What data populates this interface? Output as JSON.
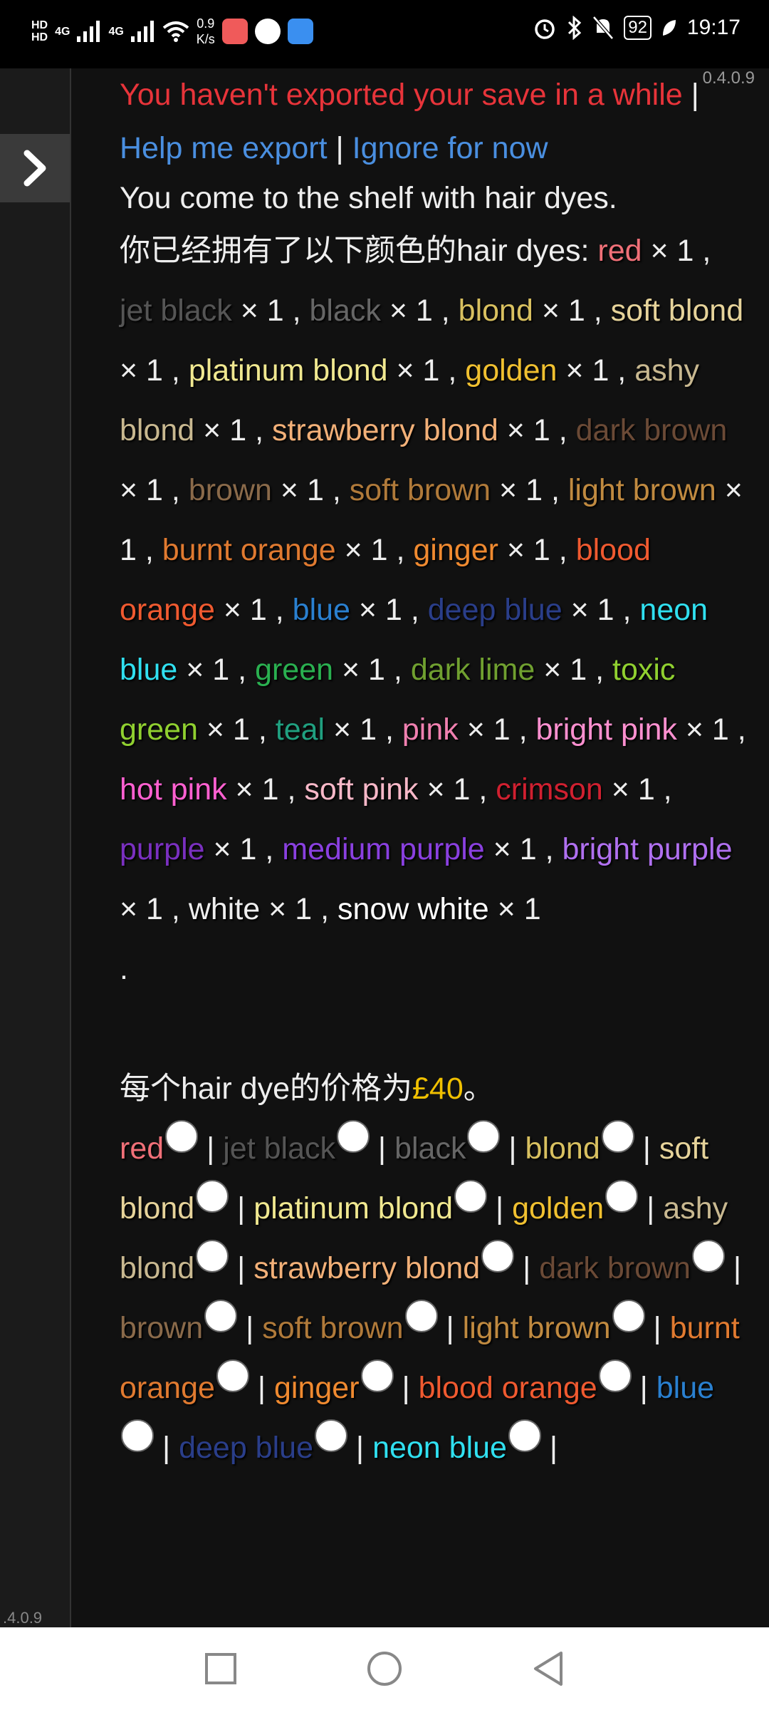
{
  "status_bar": {
    "hd1": "HD",
    "hd2": "HD",
    "sig1": "4G",
    "sig2": "4G",
    "net_speed_value": "0.9",
    "net_speed_unit": "K/s",
    "battery": "92",
    "time": "19:17"
  },
  "version": "0.4.0.9",
  "sidebar_version": ".4.0.9",
  "notice": {
    "message": "You haven't exported your save in a while",
    "sep1": " | ",
    "help": "Help me export",
    "sep2": " | ",
    "ignore": "Ignore for now"
  },
  "intro": "You come to the shelf with hair dyes.",
  "owned_prefix": "你已经拥有了以下颜色的hair dyes: ",
  "owned_count_label": " × 1",
  "owned_end": ".",
  "price_prefix": "每个hair dye的价格为",
  "price_value": "£40",
  "price_suffix": "。",
  "colors": [
    {
      "name": "red",
      "color": "#f07078"
    },
    {
      "name": "jet black",
      "color": "#555555"
    },
    {
      "name": "black",
      "color": "#666666"
    },
    {
      "name": "blond",
      "color": "#d8c060"
    },
    {
      "name": "soft blond",
      "color": "#e6d39a"
    },
    {
      "name": "platinum blond",
      "color": "#f0e890"
    },
    {
      "name": "golden",
      "color": "#f0c030"
    },
    {
      "name": "ashy blond",
      "color": "#c8b890"
    },
    {
      "name": "strawberry blond",
      "color": "#f2b078"
    },
    {
      "name": "dark brown",
      "color": "#6b4a36"
    },
    {
      "name": "brown",
      "color": "#8a6a4a"
    },
    {
      "name": "soft brown",
      "color": "#b07a3a"
    },
    {
      "name": "light brown",
      "color": "#c08a40"
    },
    {
      "name": "burnt orange",
      "color": "#e07a30"
    },
    {
      "name": "ginger",
      "color": "#f08a30"
    },
    {
      "name": "blood orange",
      "color": "#f05a30"
    },
    {
      "name": "blue",
      "color": "#2a80d0"
    },
    {
      "name": "deep blue",
      "color": "#2a3e8a"
    },
    {
      "name": "neon blue",
      "color": "#30e0f0"
    },
    {
      "name": "green",
      "color": "#2ab050"
    },
    {
      "name": "dark lime",
      "color": "#70a030"
    },
    {
      "name": "toxic green",
      "color": "#90d030"
    },
    {
      "name": "teal",
      "color": "#20a080"
    },
    {
      "name": "pink",
      "color": "#f080b0"
    },
    {
      "name": "bright pink",
      "color": "#ff90d0"
    },
    {
      "name": "hot pink",
      "color": "#ff60d0"
    },
    {
      "name": "soft pink",
      "color": "#f8b8c8"
    },
    {
      "name": "crimson",
      "color": "#d02030"
    },
    {
      "name": "purple",
      "color": "#7a30c0"
    },
    {
      "name": "medium purple",
      "color": "#8a40e0"
    },
    {
      "name": "bright purple",
      "color": "#b070f0"
    },
    {
      "name": "white",
      "color": "#eeeeee"
    },
    {
      "name": "snow white",
      "color": "#ffffff"
    }
  ],
  "buy_list_visible_count": 19,
  "buy_sep": " | "
}
